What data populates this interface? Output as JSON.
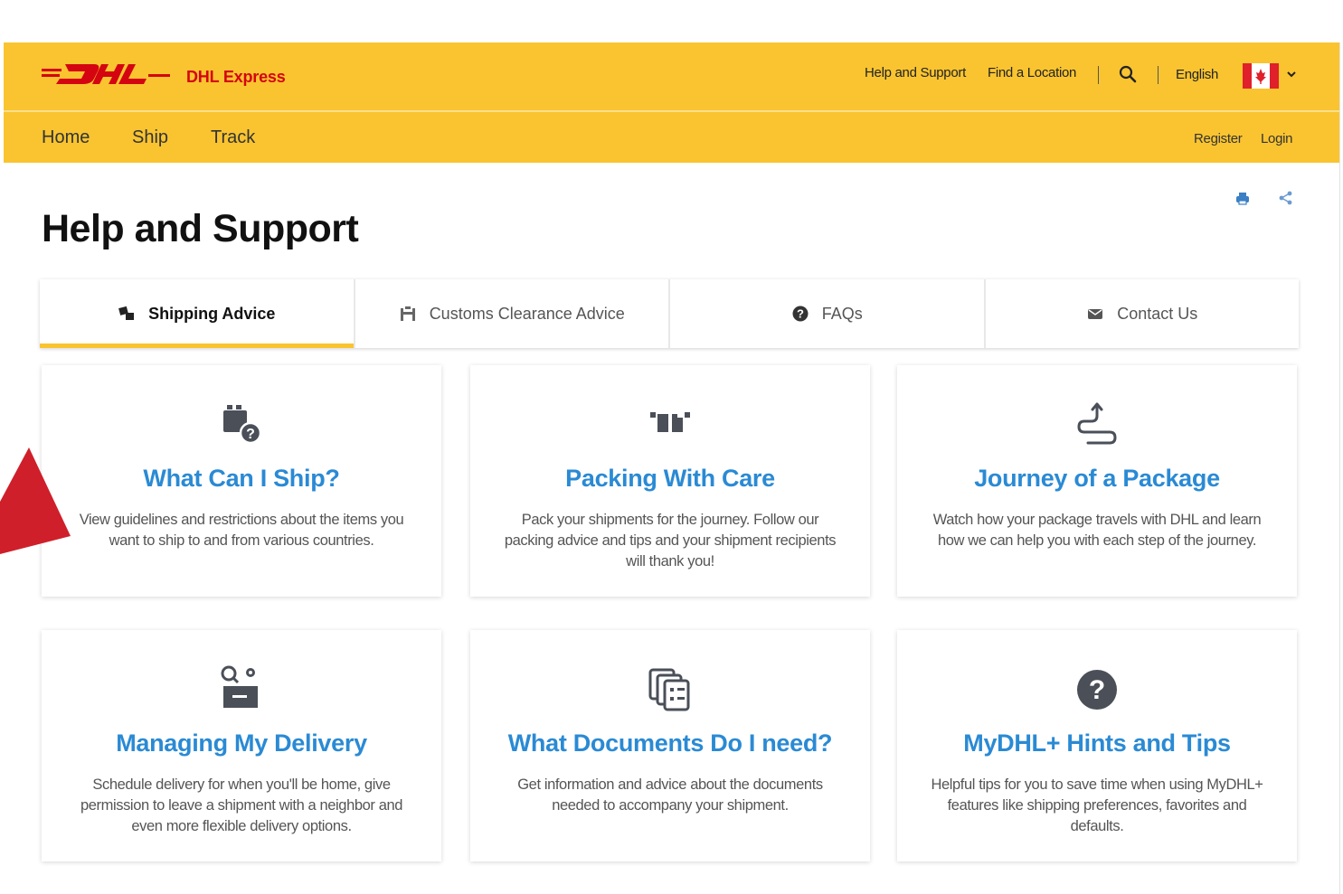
{
  "header": {
    "brand": "DHL Express",
    "help_link": "Help and Support",
    "location_link": "Find a Location",
    "language": "English"
  },
  "nav": {
    "home": "Home",
    "ship": "Ship",
    "track": "Track",
    "register": "Register",
    "login": "Login"
  },
  "page": {
    "title": "Help and Support"
  },
  "tabs": [
    {
      "label": "Shipping Advice",
      "icon": "boxes-icon",
      "active": true
    },
    {
      "label": "Customs Clearance Advice",
      "icon": "customs-icon",
      "active": false
    },
    {
      "label": "FAQs",
      "icon": "question-icon",
      "active": false
    },
    {
      "label": "Contact Us",
      "icon": "envelope-icon",
      "active": false
    }
  ],
  "cards": [
    {
      "title": "What Can I Ship?",
      "description": "View guidelines and restrictions about the items you want to ship to and from various countries.",
      "icon": "package-question-icon"
    },
    {
      "title": "Packing With Care",
      "description": "Pack your shipments for the journey. Follow our packing advice and tips and your shipment recipients will thank you!",
      "icon": "packing-icon"
    },
    {
      "title": "Journey of a Package",
      "description": "Watch how your package travels with DHL and learn how we can help you with each step of the journey.",
      "icon": "route-icon"
    },
    {
      "title": "Managing My Delivery",
      "description": "Schedule delivery for when you'll be home, give permission to leave a shipment with a neighbor and even more flexible delivery options.",
      "icon": "delivery-settings-icon"
    },
    {
      "title": "What Documents Do I need?",
      "description": "Get information and advice about the documents needed to accompany your shipment.",
      "icon": "documents-icon"
    },
    {
      "title": "MyDHL+ Hints and Tips",
      "description": "Helpful tips for you to save time when using MyDHL+ features like shipping preferences, favorites and defaults.",
      "icon": "help-circle-icon"
    }
  ],
  "colors": {
    "brand_yellow": "#f9c430",
    "brand_red": "#d40511",
    "link_blue": "#2a8ad4"
  }
}
